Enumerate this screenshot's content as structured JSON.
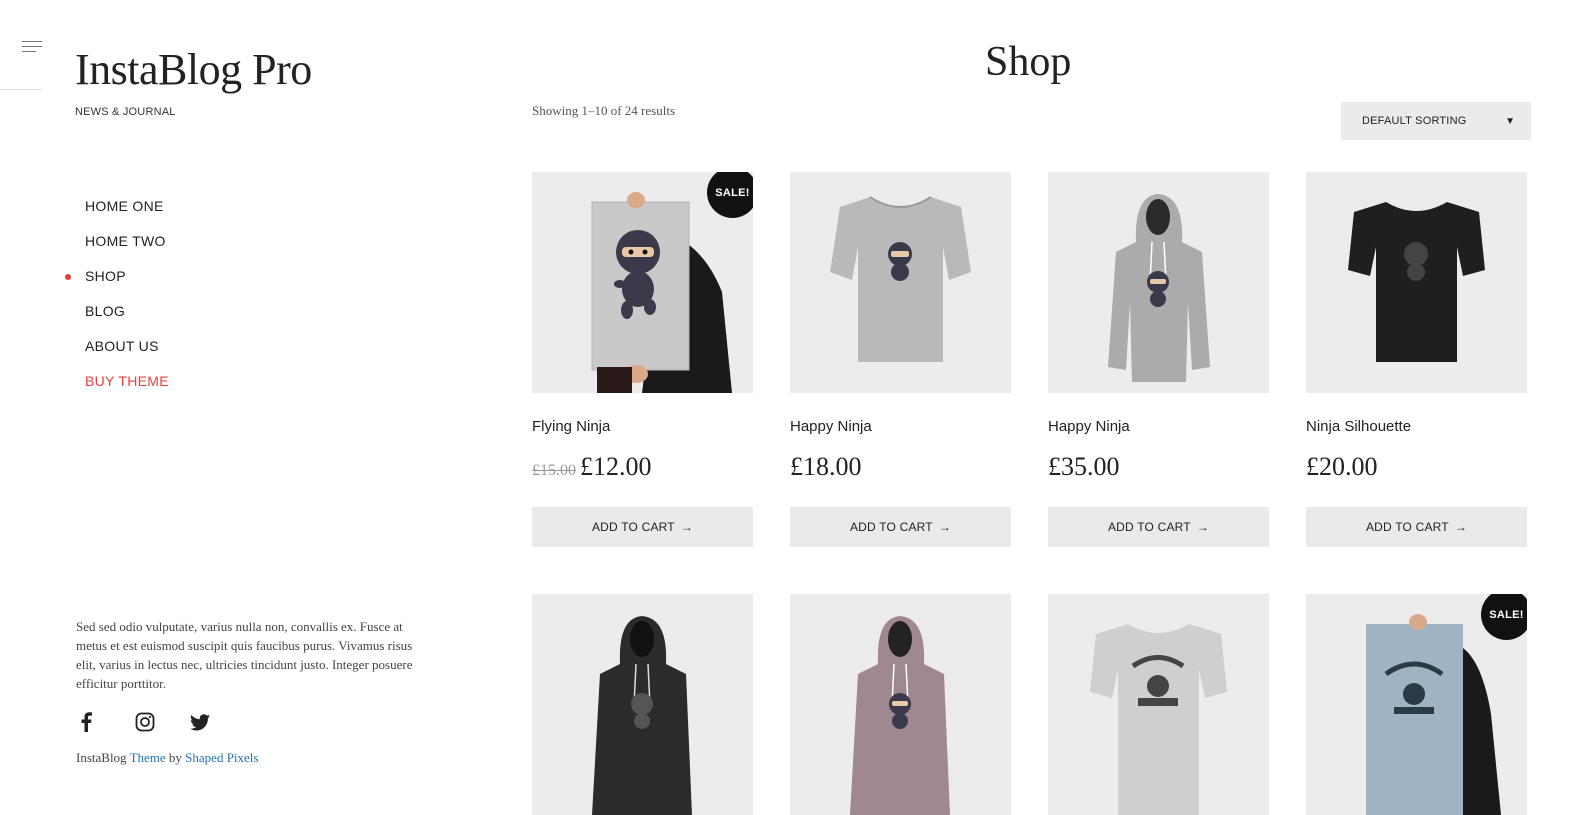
{
  "site": {
    "title": "InstaBlog Pro",
    "tagline": "NEWS & JOURNAL"
  },
  "nav": [
    {
      "label": "HOME ONE",
      "active": false,
      "accent": false
    },
    {
      "label": "HOME TWO",
      "active": false,
      "accent": false
    },
    {
      "label": "SHOP",
      "active": true,
      "accent": false
    },
    {
      "label": "BLOG",
      "active": false,
      "accent": false
    },
    {
      "label": "ABOUT US",
      "active": false,
      "accent": false
    },
    {
      "label": "BUY THEME",
      "active": false,
      "accent": true
    }
  ],
  "sidebar": {
    "about": "Sed sed odio vulputate, varius nulla non, convallis ex. Fusce at metus et est euismod suscipit quis faucibus purus. Vivamus risus elit, varius in lectus nec, ultricies tincidunt justo. Integer posuere efficitur porttitor.",
    "socials": [
      "facebook-icon",
      "instagram-icon",
      "twitter-icon"
    ],
    "credits": {
      "prefix": "InstaBlog",
      "theme_link": "Theme",
      "by": "by",
      "author_link": "Shaped Pixels"
    }
  },
  "shop": {
    "title": "Shop",
    "result_count": "Showing 1–10 of 24 results",
    "sorting": "DEFAULT SORTING",
    "sale_badge": "SALE!",
    "add_to_cart": "ADD TO CART",
    "products": [
      {
        "name": "Flying Ninja",
        "old_price": "£15.00",
        "price": "£12.00",
        "sale": true,
        "image": "poster-ninja"
      },
      {
        "name": "Happy Ninja",
        "old_price": "",
        "price": "£18.00",
        "sale": false,
        "image": "grey-tshirt-ninja"
      },
      {
        "name": "Happy Ninja",
        "old_price": "",
        "price": "£35.00",
        "sale": false,
        "image": "grey-hoodie-ninja"
      },
      {
        "name": "Ninja Silhouette",
        "old_price": "",
        "price": "£20.00",
        "sale": false,
        "image": "black-tshirt-silhouette"
      },
      {
        "name": "",
        "old_price": "",
        "price": "",
        "sale": false,
        "image": "black-hoodie-silhouette"
      },
      {
        "name": "",
        "old_price": "",
        "price": "",
        "sale": false,
        "image": "pink-hoodie-ninja"
      },
      {
        "name": "",
        "old_price": "",
        "price": "",
        "sale": false,
        "image": "white-tshirt-woothemes"
      },
      {
        "name": "",
        "old_price": "",
        "price": "",
        "sale": true,
        "image": "blue-poster-woothemes"
      }
    ]
  },
  "colors": {
    "accent": "#ef3d3d",
    "link": "#1e73be",
    "button_bg": "#ebe9e9",
    "thumb_bg": "#ececec"
  }
}
